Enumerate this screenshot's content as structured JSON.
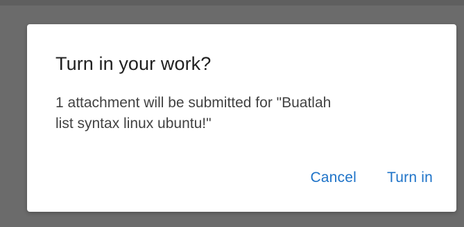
{
  "dialog": {
    "title": "Turn in your work?",
    "message_line1": "1 attachment will be submitted for \"Buatlah",
    "message_line2": "list syntax linux ubuntu!\"",
    "cancel_label": "Cancel",
    "confirm_label": "Turn in"
  },
  "colors": {
    "scrim": "#6b6b6b",
    "surface": "#ffffff",
    "title_text": "#212121",
    "body_text": "#424242",
    "accent": "#1e73c8"
  }
}
